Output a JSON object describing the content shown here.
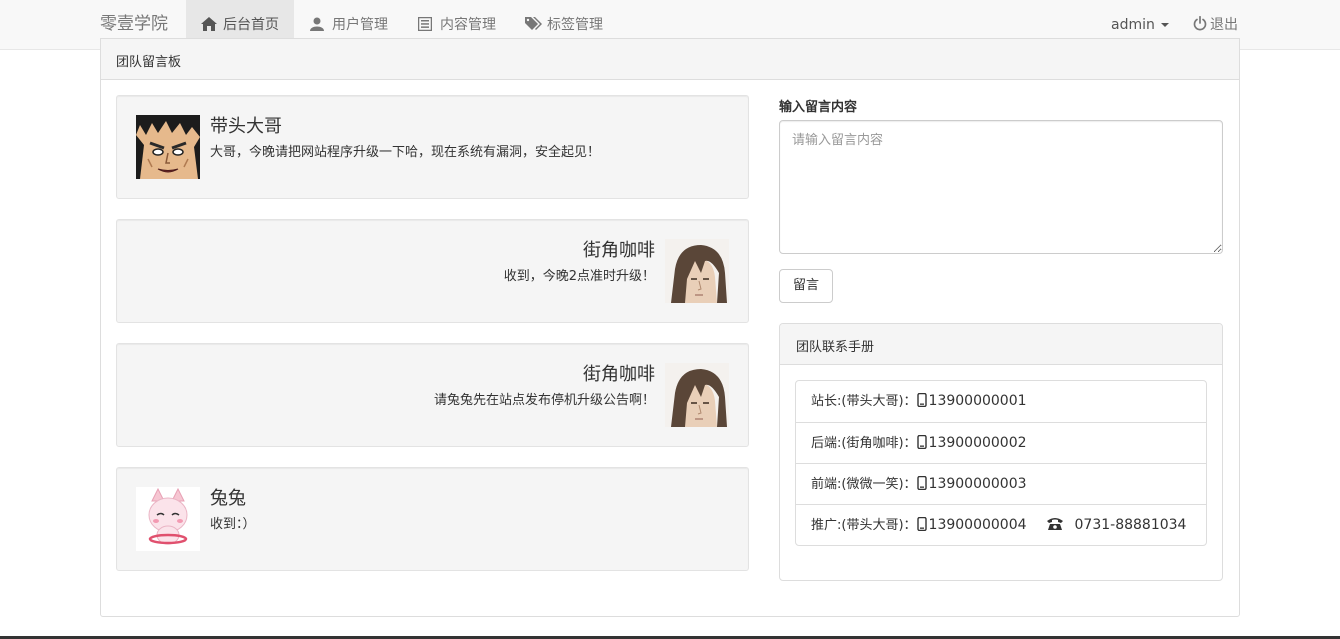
{
  "navbar": {
    "brand": "零壹学院",
    "items": [
      {
        "label": "后台首页",
        "icon": "home-icon",
        "active": true
      },
      {
        "label": "用户管理",
        "icon": "user-icon"
      },
      {
        "label": "内容管理",
        "icon": "list-alt-icon"
      },
      {
        "label": "标签管理",
        "icon": "tags-icon"
      }
    ],
    "user": {
      "label": "admin"
    },
    "logout": {
      "label": "退出",
      "icon": "power-icon"
    }
  },
  "board": {
    "title": "团队留言板",
    "messages": [
      {
        "author": "带头大哥",
        "text": "大哥，今晚请把网站程序升级一下哈，现在系统有漏洞，安全起见！",
        "align": "left",
        "avatar": "goku-avatar"
      },
      {
        "author": "街角咖啡",
        "text": "收到，今晚2点准时升级！",
        "align": "right",
        "avatar": "squall-avatar"
      },
      {
        "author": "街角咖啡",
        "text": "请兔兔先在站点发布停机升级公告啊！",
        "align": "right",
        "avatar": "squall-avatar"
      },
      {
        "author": "兔兔",
        "text": "收到：）",
        "align": "left",
        "avatar": "bunny-avatar"
      }
    ]
  },
  "form": {
    "label": "输入留言内容",
    "placeholder": "请输入留言内容",
    "submit": "留言"
  },
  "contacts": {
    "title": "团队联系手册",
    "rows": [
      {
        "label": "站长:(带头大哥)：",
        "phone": "13900000001"
      },
      {
        "label": "后端:(街角咖啡)：",
        "phone": "13900000002"
      },
      {
        "label": "前端:(微微一笑)：",
        "phone": "13900000003"
      },
      {
        "label": "推广:(带头大哥)：",
        "phone": "13900000004",
        "tel": "0731-88881034"
      }
    ]
  },
  "colors": {
    "navbar_bg": "#f8f8f8",
    "active_bg": "#e7e7e7",
    "well_bg": "#f5f5f5",
    "border": "#dddddd"
  }
}
